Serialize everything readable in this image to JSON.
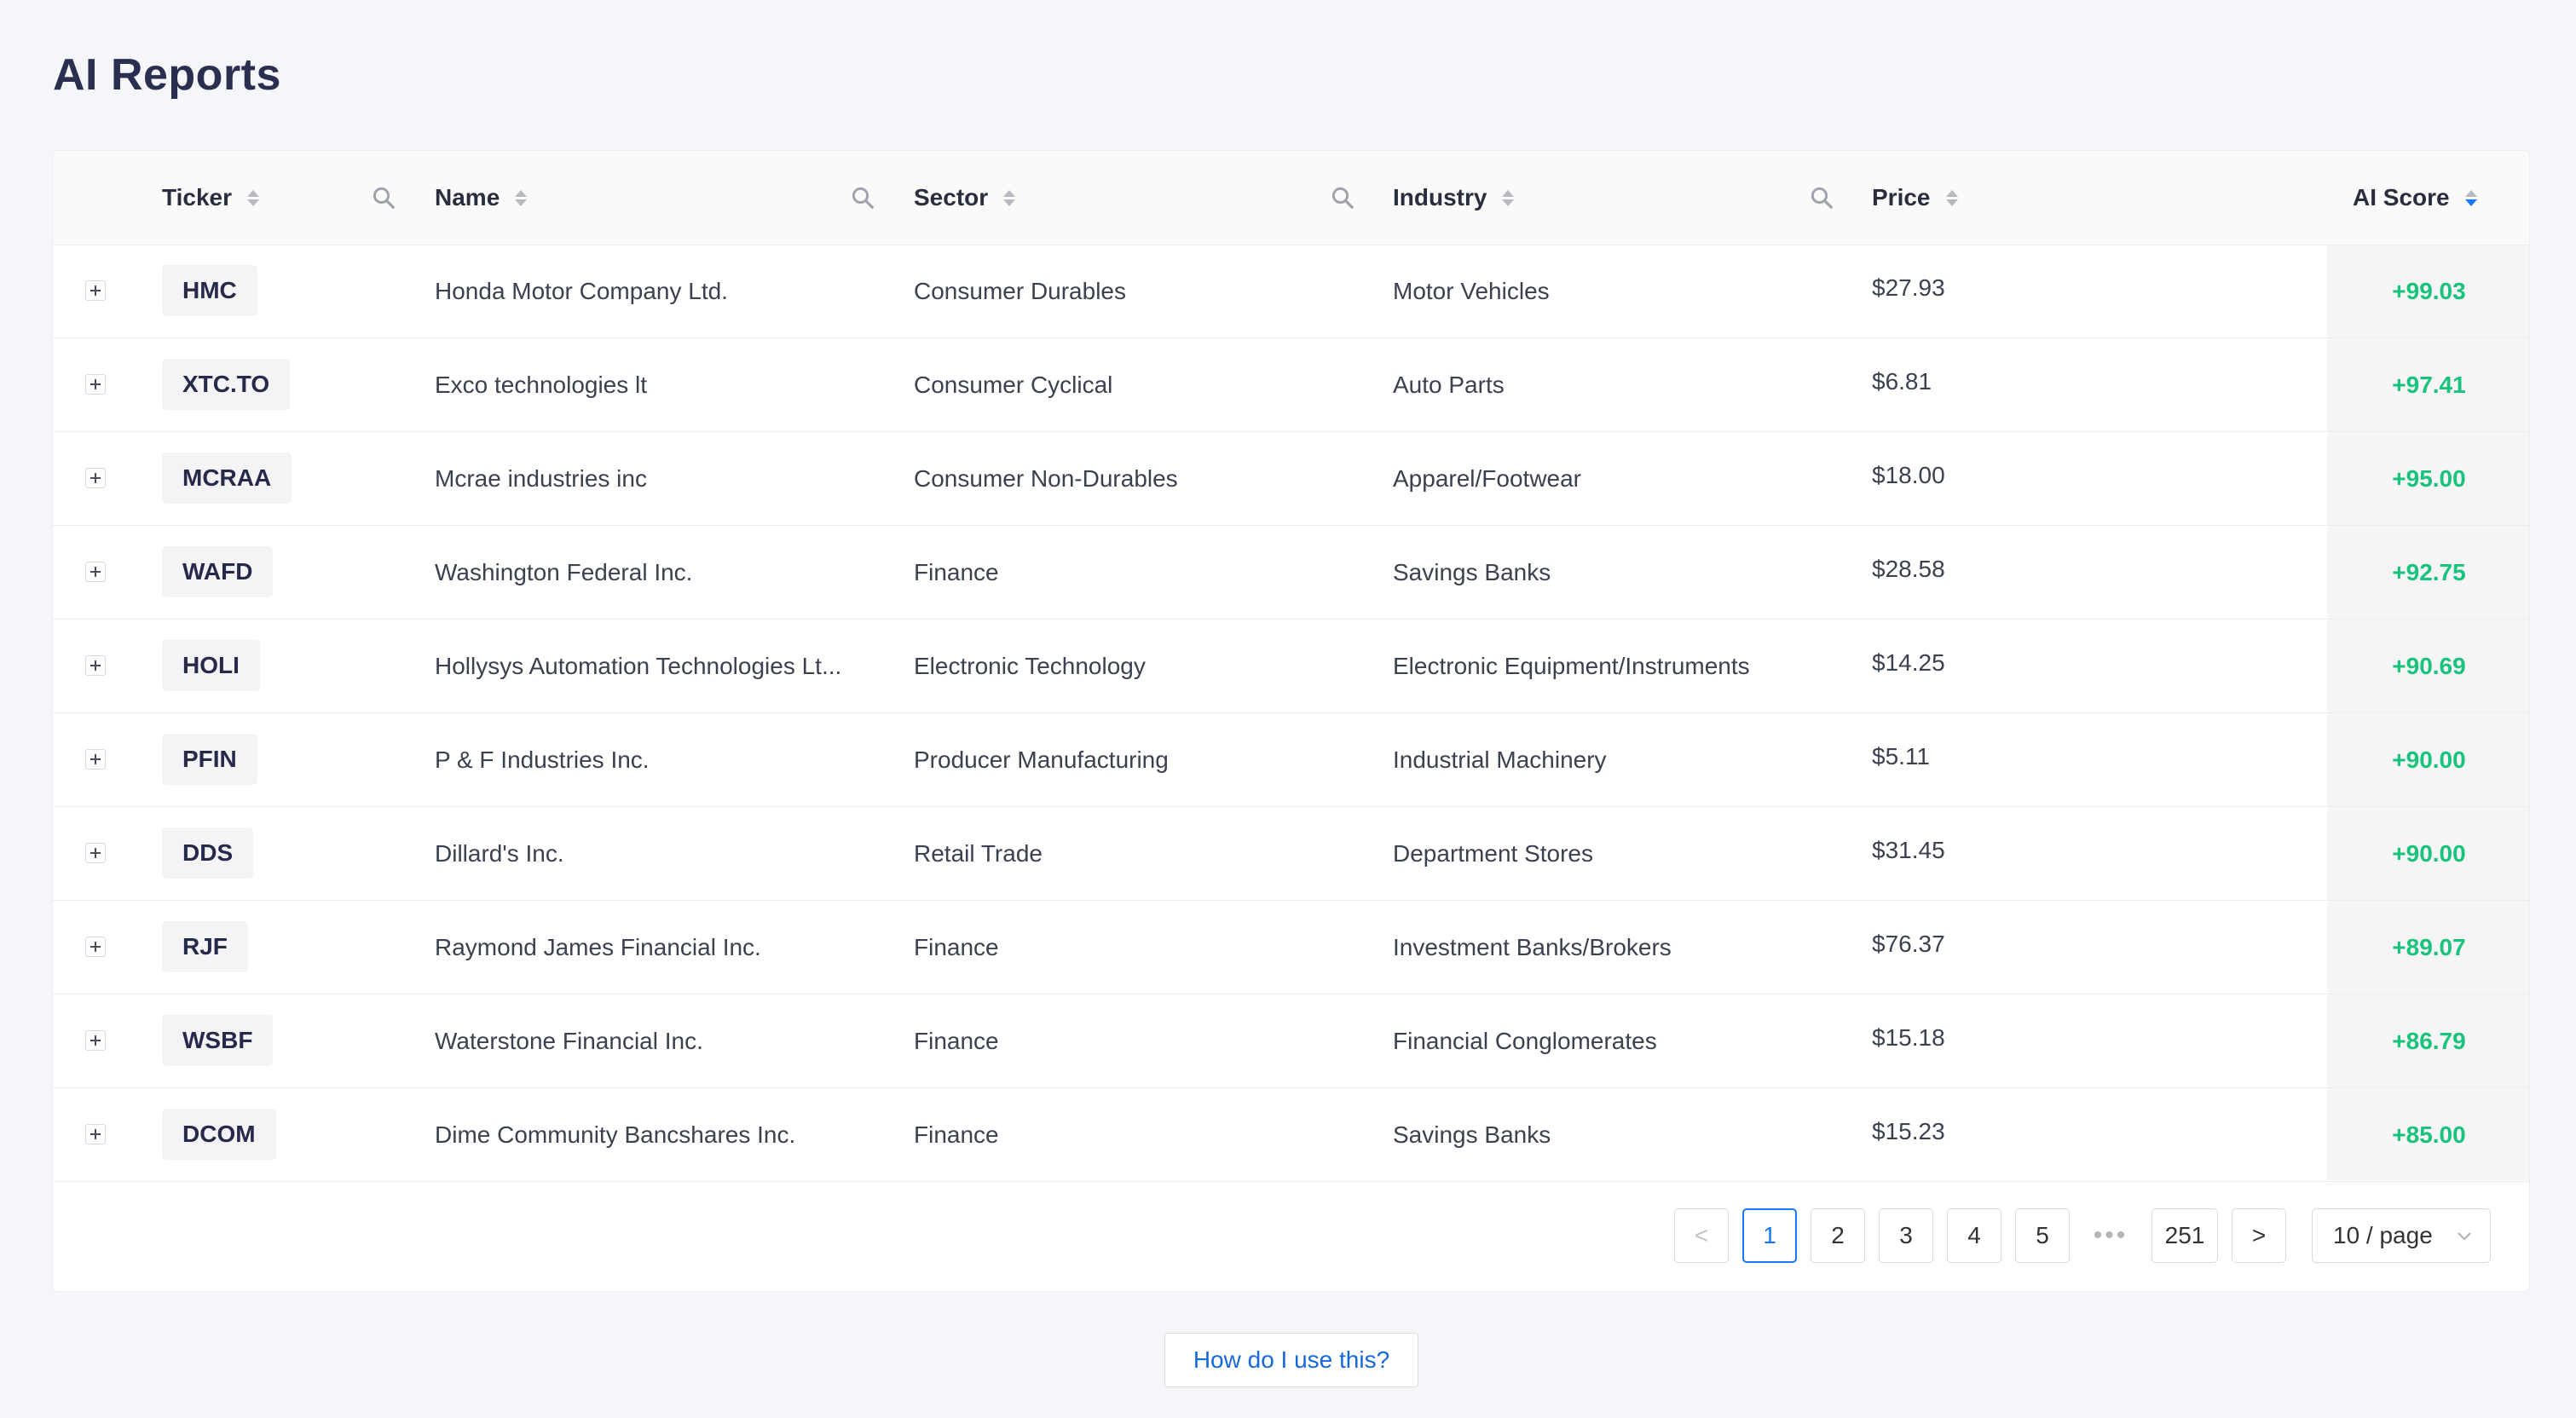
{
  "page": {
    "title": "AI Reports"
  },
  "table": {
    "columns": {
      "ticker": "Ticker",
      "name": "Name",
      "sector": "Sector",
      "industry": "Industry",
      "price": "Price",
      "ai_score": "AI Score"
    },
    "sort": {
      "column": "ai_score",
      "direction": "descending"
    },
    "rows": [
      {
        "ticker": "HMC",
        "name": "Honda Motor Company Ltd.",
        "sector": "Consumer Durables",
        "industry": "Motor Vehicles",
        "price": "$27.93",
        "score": "+99.03"
      },
      {
        "ticker": "XTC.TO",
        "name": "Exco technologies lt",
        "sector": "Consumer Cyclical",
        "industry": "Auto Parts",
        "price": "$6.81",
        "score": "+97.41"
      },
      {
        "ticker": "MCRAA",
        "name": "Mcrae industries inc",
        "sector": "Consumer Non-Durables",
        "industry": "Apparel/Footwear",
        "price": "$18.00",
        "score": "+95.00"
      },
      {
        "ticker": "WAFD",
        "name": "Washington Federal Inc.",
        "sector": "Finance",
        "industry": "Savings Banks",
        "price": "$28.58",
        "score": "+92.75"
      },
      {
        "ticker": "HOLI",
        "name": "Hollysys Automation Technologies Lt...",
        "sector": "Electronic Technology",
        "industry": "Electronic Equipment/Instruments",
        "price": "$14.25",
        "score": "+90.69"
      },
      {
        "ticker": "PFIN",
        "name": "P & F Industries Inc.",
        "sector": "Producer Manufacturing",
        "industry": "Industrial Machinery",
        "price": "$5.11",
        "score": "+90.00"
      },
      {
        "ticker": "DDS",
        "name": "Dillard's Inc.",
        "sector": "Retail Trade",
        "industry": "Department Stores",
        "price": "$31.45",
        "score": "+90.00"
      },
      {
        "ticker": "RJF",
        "name": "Raymond James Financial Inc.",
        "sector": "Finance",
        "industry": "Investment Banks/Brokers",
        "price": "$76.37",
        "score": "+89.07"
      },
      {
        "ticker": "WSBF",
        "name": "Waterstone Financial Inc.",
        "sector": "Finance",
        "industry": "Financial Conglomerates",
        "price": "$15.18",
        "score": "+86.79"
      },
      {
        "ticker": "DCOM",
        "name": "Dime Community Bancshares Inc.",
        "sector": "Finance",
        "industry": "Savings Banks",
        "price": "$15.23",
        "score": "+85.00"
      }
    ]
  },
  "pagination": {
    "prev": "<",
    "next": ">",
    "pages": [
      "1",
      "2",
      "3",
      "4",
      "5"
    ],
    "current": "1",
    "ellipsis": "•••",
    "last": "251",
    "page_size": "10 / page"
  },
  "help_button": "How do I use this?",
  "colors": {
    "accent": "#1677ff",
    "score_positive": "#19c37d",
    "title": "#2b2f4f"
  }
}
